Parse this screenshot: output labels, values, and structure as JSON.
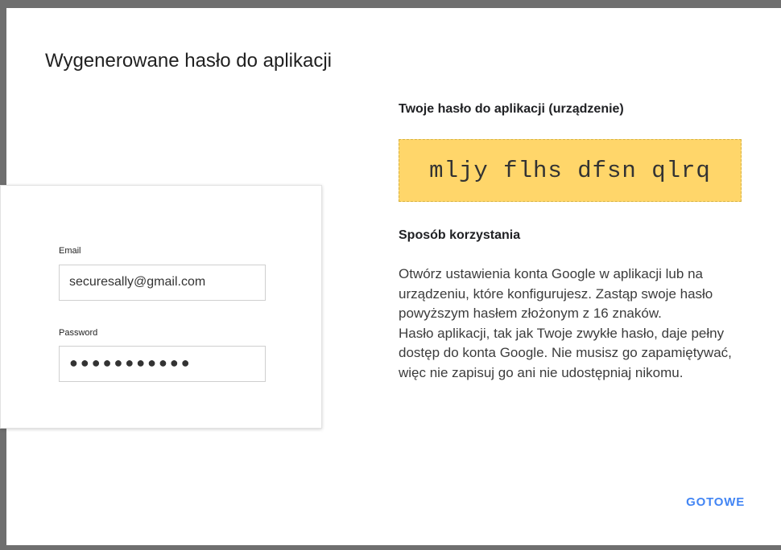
{
  "dialog": {
    "title": "Wygenerowane hasło do aplikacji",
    "password_heading": "Twoje hasło do aplikacji (urządzenie)",
    "generated_password": "mljy flhs dfsn qlrq",
    "usage_heading": "Sposób korzystania",
    "usage_paragraph_1": "Otwórz ustawienia konta Google w aplikacji lub na urządzeniu, które konfigurujesz. Zastąp swoje hasło powyższym hasłem złożonym z 16 znaków.",
    "usage_paragraph_2": "Hasło aplikacji, tak jak Twoje zwykłe hasło, daje pełny dostęp do konta Google. Nie musisz go zapamiętywać, więc nie zapisuj go ani nie udostępniaj nikomu.",
    "done_label": "GOTOWE"
  },
  "login_card": {
    "email_label": "Email",
    "email_value": "securesally@gmail.com",
    "password_label": "Password",
    "password_value": "●●●●●●●●●●●"
  },
  "colors": {
    "password_highlight": "#ffd66a",
    "accent": "#4285f4"
  }
}
